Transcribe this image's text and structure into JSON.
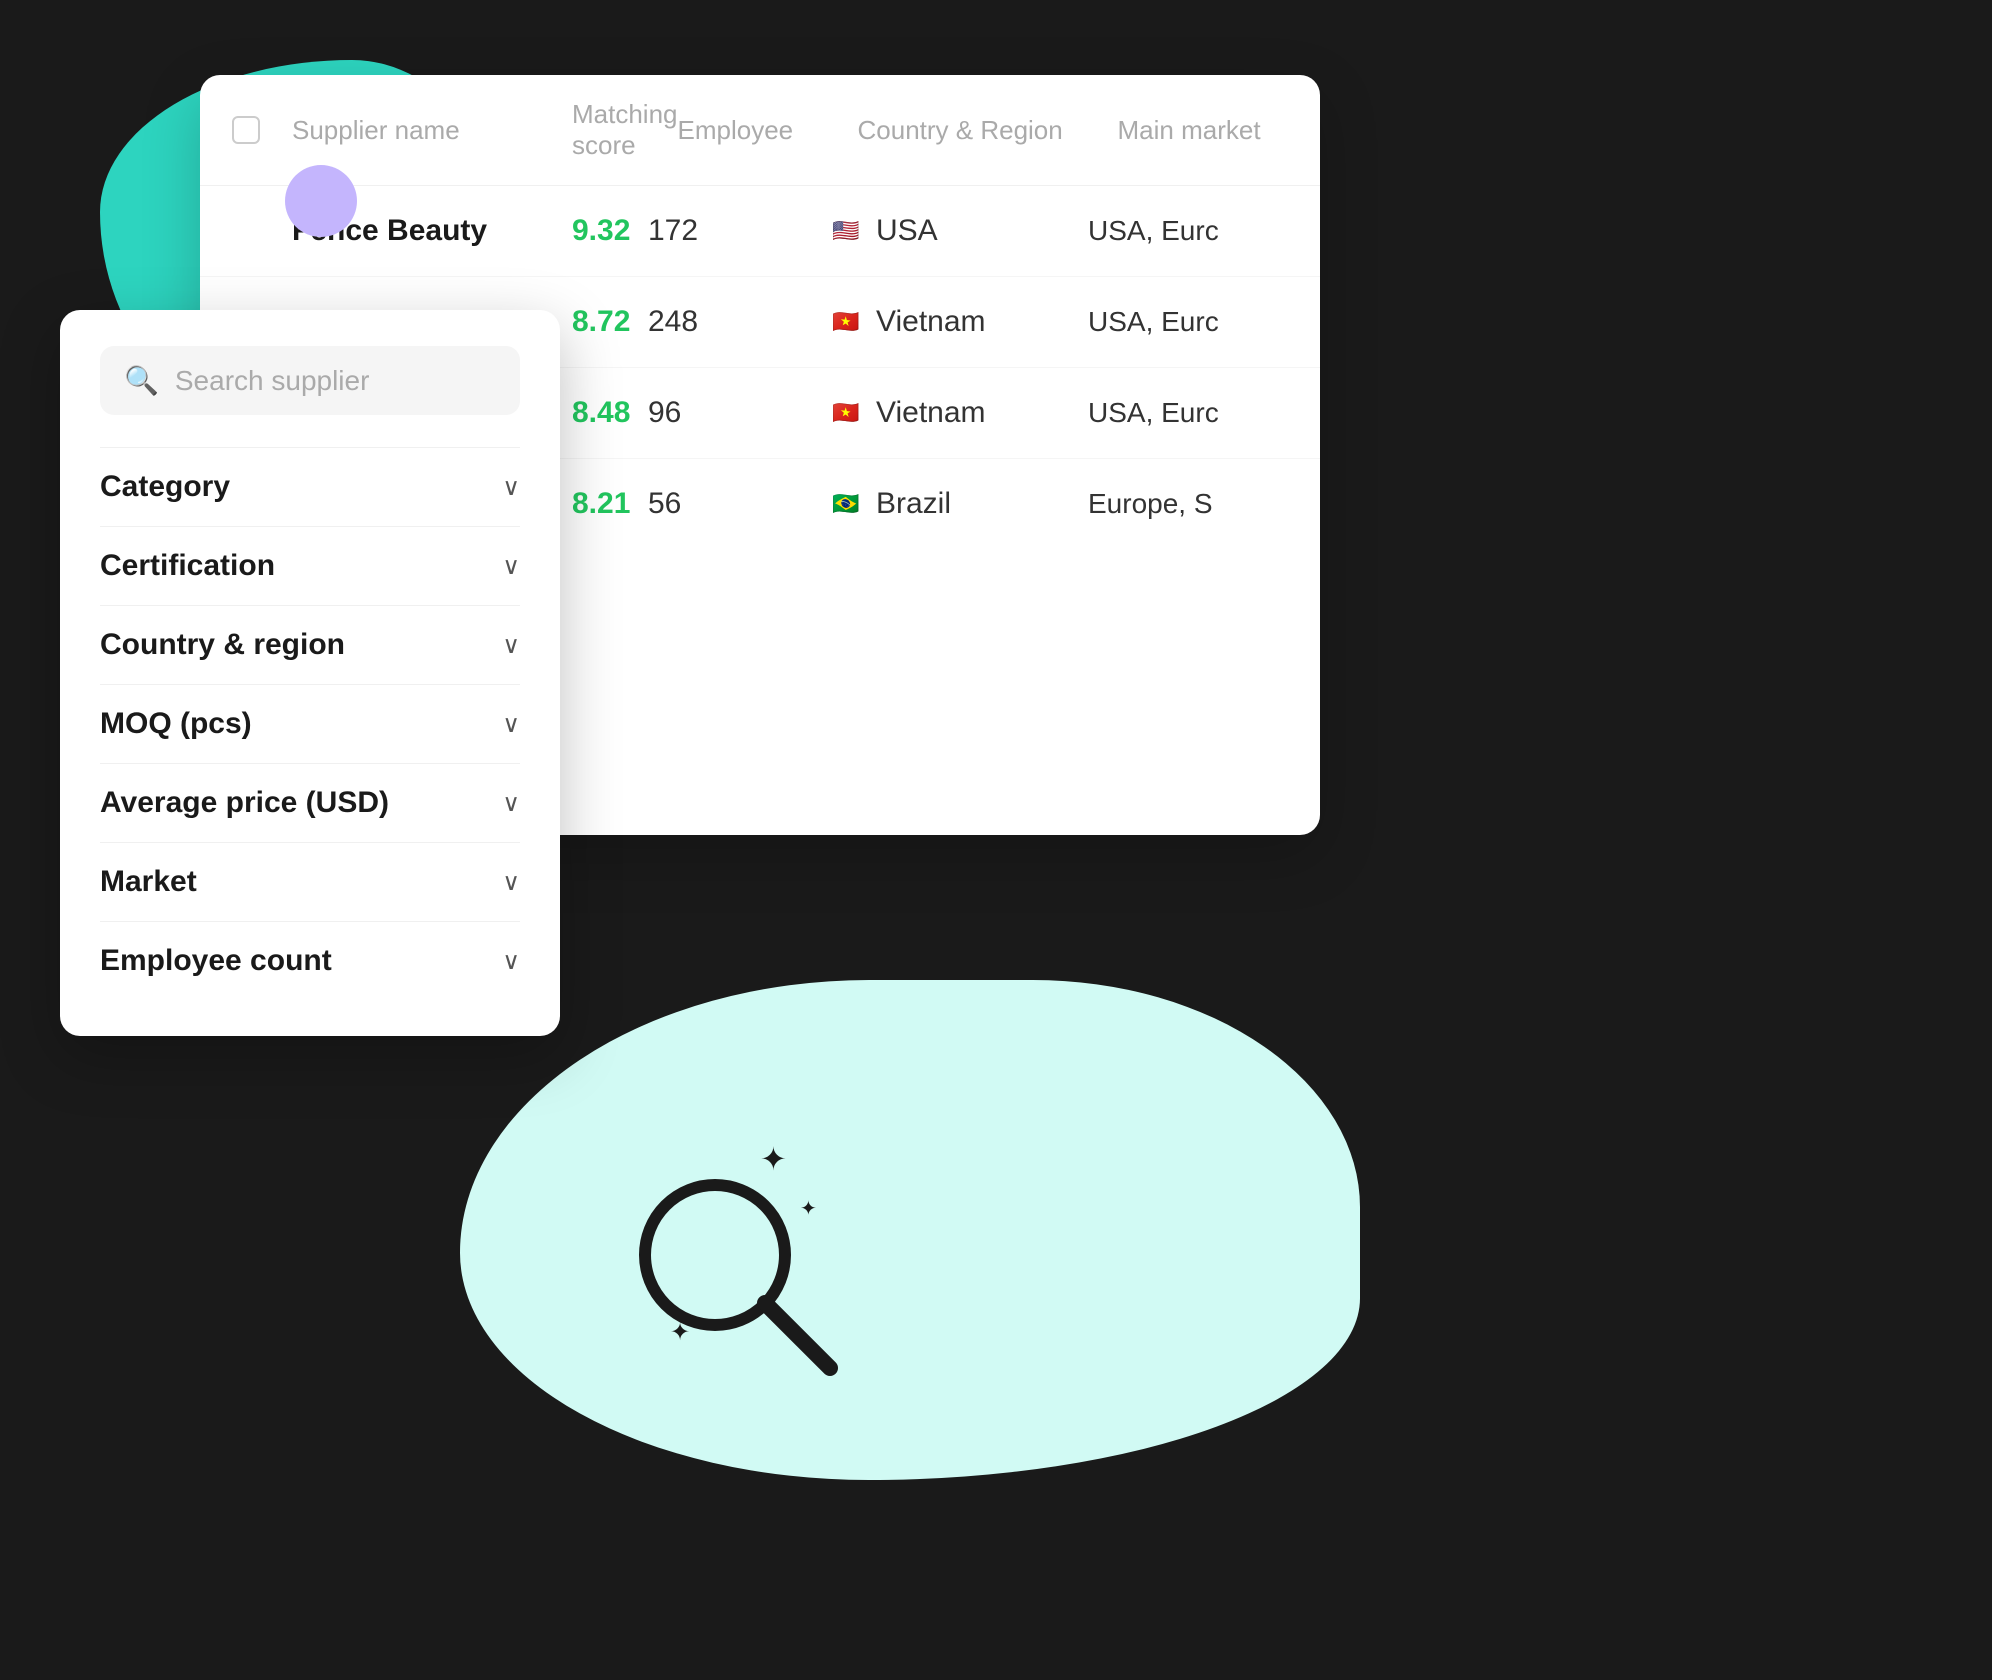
{
  "table": {
    "columns": [
      "",
      "Supplier name",
      "Matching score",
      "Employee",
      "Country & Region",
      "Main market"
    ],
    "rows": [
      {
        "name": "Fence Beauty",
        "score": "9.32",
        "employees": "172",
        "country": "USA",
        "flag": "🇺🇸",
        "market": "USA, Eurc"
      },
      {
        "name": "",
        "score": "8.72",
        "employees": "248",
        "country": "Vietnam",
        "flag": "🇻🇳",
        "market": "USA, Eurc"
      },
      {
        "name": "",
        "score": "8.48",
        "employees": "96",
        "country": "Vietnam",
        "flag": "🇻🇳",
        "market": "USA, Eurc"
      },
      {
        "name": "",
        "score": "8.21",
        "employees": "56",
        "country": "Brazil",
        "flag": "🇧🇷",
        "market": "Europe, S"
      }
    ]
  },
  "filter": {
    "search_placeholder": "Search supplier",
    "items": [
      {
        "label": "Category",
        "id": "category"
      },
      {
        "label": "Certification",
        "id": "certification"
      },
      {
        "label": "Country & region",
        "id": "country-region"
      },
      {
        "label": "MOQ (pcs)",
        "id": "moq"
      },
      {
        "label": "Average price (USD)",
        "id": "avg-price"
      },
      {
        "label": "Market",
        "id": "market"
      },
      {
        "label": "Employee count",
        "id": "employee-count"
      }
    ]
  }
}
